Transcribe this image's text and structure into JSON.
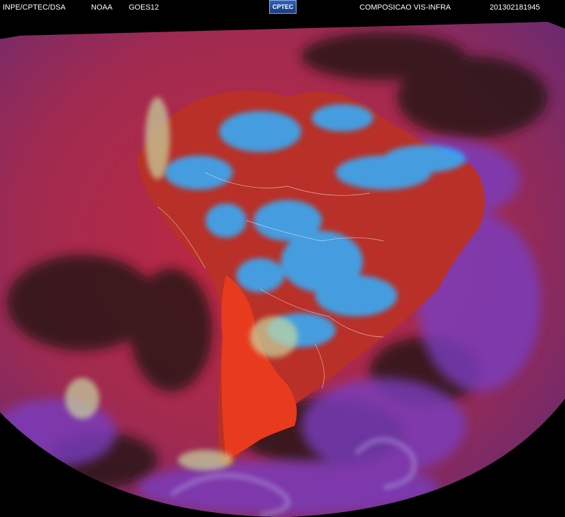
{
  "header": {
    "agency": "INPE/CPTEC/DSA",
    "partner": "NOAA",
    "satellite": "GOES12",
    "logo_text": "CPTEC",
    "product": "COMPOSICAO VIS-INFRA",
    "timestamp": "201302181945"
  },
  "colors": {
    "background": "#000000",
    "ocean_red": "#c02840",
    "land_red": "#e03020",
    "cloud_cyan": "#30b0ff",
    "cloud_violet": "#7a3cc0",
    "earth_edge_gray": "#9a9a9a"
  }
}
